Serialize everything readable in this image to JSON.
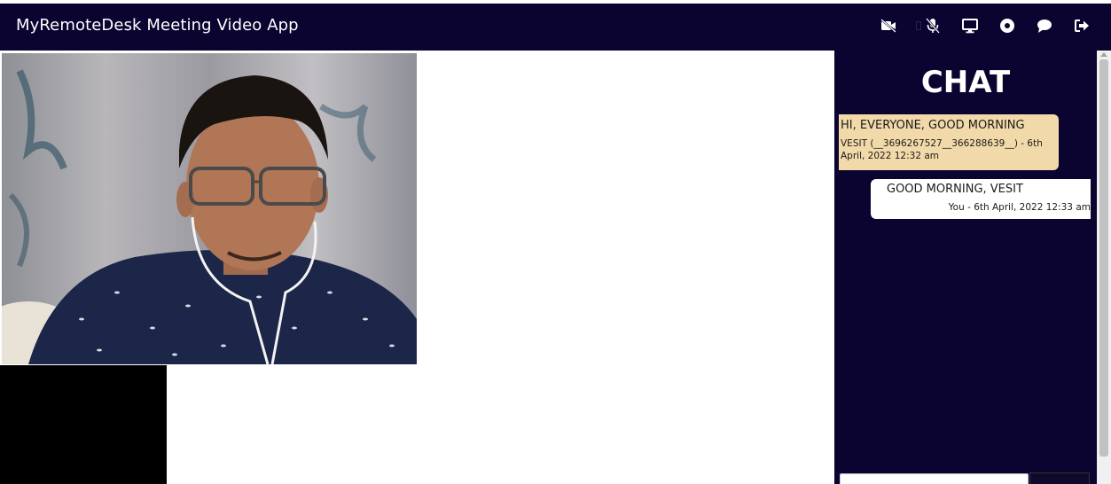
{
  "app": {
    "title": "MyRemoteDesk Meeting Video App"
  },
  "toolbar": {
    "icons": [
      "video-off-icon",
      "microphone-off-icon",
      "screen-share-icon",
      "record-icon",
      "chat-bubble-icon",
      "leave-meeting-icon"
    ],
    "icon_color": "#ffffff",
    "background": "#0b0330"
  },
  "videos": {
    "main": "local camera feed",
    "secondary": "remote participant (black)"
  },
  "chat": {
    "title": "CHAT",
    "messages": [
      {
        "text": "HI, EVERYONE, GOOD MORNING",
        "meta_line1": "VESIT (__3696267527__366288639__) - 6th",
        "meta_line2": "April, 2022 12:32 am",
        "direction": "incoming",
        "color": "#f2d9a9"
      },
      {
        "text": "GOOD MORNING, VESIT",
        "meta": "You - 6th April, 2022 12:33 am",
        "direction": "outgoing",
        "color": "#ffffff"
      }
    ],
    "input": {
      "value": "",
      "placeholder": ""
    }
  }
}
